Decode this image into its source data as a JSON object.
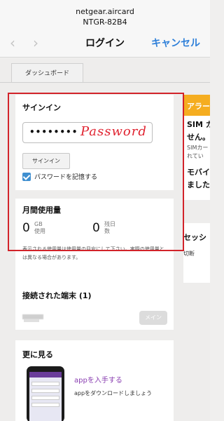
{
  "browser": {
    "url_line1": "netgear.aircard",
    "url_line2": "NTGR-82B4",
    "title": "ログイン",
    "cancel": "キャンセル",
    "back_icon": "chevron-left-icon",
    "forward_icon": "chevron-right-icon"
  },
  "tab": {
    "label": "ダッシュボード"
  },
  "signin": {
    "title": "サインイン",
    "password_value": "••••••••",
    "password_annotation": "Password",
    "button": "サインイン",
    "remember_label": "パスワードを記憶する",
    "remember_checked": true
  },
  "alert": {
    "title": "アラー",
    "line1": "SIM カ",
    "line2": "せん。",
    "sub1": "SIMカー",
    "sub2": "れてい",
    "line3": "モバイ",
    "line4": "ました"
  },
  "usage": {
    "title": "月間使用量",
    "used_value": "0",
    "used_unit1": "GB",
    "used_unit2": "使用",
    "days_value": "0",
    "days_unit1": "残日",
    "days_unit2": "数",
    "note": "表示される使用量は使用量の目安にして下さい。実際の使用量とは異なる場合があります。"
  },
  "session": {
    "title": "セッシ",
    "sub": "切断"
  },
  "devices": {
    "title": "接続された端末 (1)",
    "main_button": "メイン"
  },
  "more": {
    "title": "更に見る",
    "get_app": "appを入手する",
    "download_app": "appをダウンロードしましょう"
  },
  "colors": {
    "accent": "#2f80d9",
    "alert": "#f5ad20",
    "highlight": "#d2232a",
    "app_link": "#8a3fb1"
  }
}
